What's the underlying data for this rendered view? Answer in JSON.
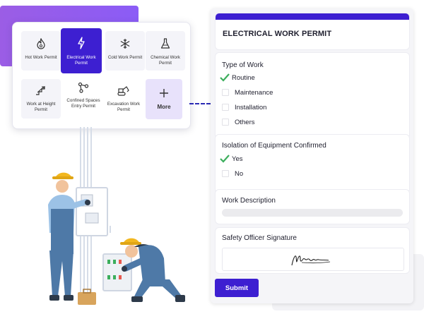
{
  "permit_types": [
    {
      "label": "Hot Work Permit",
      "icon": "flame-icon"
    },
    {
      "label": "Electrical Work Permit",
      "icon": "lightning-icon",
      "selected": true
    },
    {
      "label": "Cold Work Permit",
      "icon": "snowflake-icon"
    },
    {
      "label": "Chemical Work Permit",
      "icon": "flask-icon"
    },
    {
      "label": "Work at Height Permit",
      "icon": "stairs-icon"
    },
    {
      "label": "Confined Spaces Entry Permit",
      "icon": "nodes-icon"
    },
    {
      "label": "Excavation Work Permit",
      "icon": "excavator-icon"
    },
    {
      "label": "More",
      "icon": "plus-icon"
    }
  ],
  "form": {
    "title": "ELECTRICAL WORK PERMIT",
    "type_of_work": {
      "label": "Type of Work",
      "options": [
        {
          "label": "Routine",
          "checked": true
        },
        {
          "label": "Maintenance",
          "checked": false
        },
        {
          "label": "Installation",
          "checked": false
        },
        {
          "label": "Others",
          "checked": false
        }
      ]
    },
    "isolation": {
      "label": "Isolation of Equipment Confirmed",
      "options": [
        {
          "label": "Yes",
          "checked": true
        },
        {
          "label": "No",
          "checked": false
        }
      ]
    },
    "work_description": {
      "label": "Work Description",
      "value": ""
    },
    "signature": {
      "label": "Safety Officer Signature"
    },
    "submit_label": "Submit"
  },
  "colors": {
    "accent": "#3d1fd1",
    "check": "#3cae5c",
    "purple_band": "#9b5de5"
  }
}
